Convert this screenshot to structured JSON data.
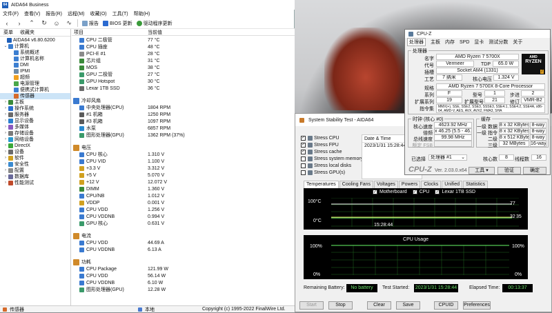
{
  "aida": {
    "title": "AIDA64 Business",
    "icon_text": "64",
    "menu": [
      "文件(F)",
      "查看(V)",
      "报告(R)",
      "远程(M)",
      "收藏(O)",
      "工具(T)",
      "帮助(H)"
    ],
    "toolbar": {
      "report": "报告",
      "bios": "BIOS 更新",
      "driver": "驱动程序更新"
    },
    "tabs": [
      "菜单",
      "收藏夹"
    ],
    "tree": [
      {
        "label": "AIDA64 v6.80.6200",
        "level": 0,
        "chev": "",
        "icon": "#1f5fb8"
      },
      {
        "label": "计算机",
        "level": 1,
        "chev": "⌄",
        "icon": "#3c7fd1"
      },
      {
        "label": "系统概述",
        "level": 2,
        "chev": "",
        "icon": "#3c7fd1"
      },
      {
        "label": "计算机名称",
        "level": 2,
        "chev": "",
        "icon": "#3c7fd1"
      },
      {
        "label": "DMI",
        "level": 2,
        "chev": "",
        "icon": "#3c7fd1"
      },
      {
        "label": "IPMI",
        "level": 2,
        "chev": "",
        "icon": "#6c8aa8"
      },
      {
        "label": "超频",
        "level": 2,
        "chev": "",
        "icon": "#f0a020"
      },
      {
        "label": "电源管理",
        "level": 2,
        "chev": "",
        "icon": "#4aa84a"
      },
      {
        "label": "便携式计算机",
        "level": 2,
        "chev": "",
        "icon": "#3c7fd1"
      },
      {
        "label": "传感器",
        "level": 2,
        "chev": "",
        "icon": "#d66a2a",
        "selected": true
      },
      {
        "label": "主板",
        "level": 1,
        "chev": "›",
        "icon": "#3a8a3a"
      },
      {
        "label": "操作系统",
        "level": 1,
        "chev": "›",
        "icon": "#2a6fd0"
      },
      {
        "label": "服务器",
        "level": 1,
        "chev": "›",
        "icon": "#6a6a6a"
      },
      {
        "label": "显示设备",
        "level": 1,
        "chev": "›",
        "icon": "#2a7fd0"
      },
      {
        "label": "多媒体",
        "level": 1,
        "chev": "›",
        "icon": "#8a5ac0"
      },
      {
        "label": "存储设备",
        "level": 1,
        "chev": "›",
        "icon": "#7a7a7a"
      },
      {
        "label": "网络设备",
        "level": 1,
        "chev": "›",
        "icon": "#2a9ad0"
      },
      {
        "label": "DirectX",
        "level": 1,
        "chev": "›",
        "icon": "#3aa83a"
      },
      {
        "label": "设备",
        "level": 1,
        "chev": "›",
        "icon": "#6a6a6a"
      },
      {
        "label": "软件",
        "level": 1,
        "chev": "›",
        "icon": "#d0a020"
      },
      {
        "label": "安全性",
        "level": 1,
        "chev": "›",
        "icon": "#3a8ad0"
      },
      {
        "label": "配置",
        "level": 1,
        "chev": "›",
        "icon": "#8a8a8a"
      },
      {
        "label": "数据库",
        "level": 1,
        "chev": "›",
        "icon": "#6a6a9a"
      },
      {
        "label": "性能测试",
        "level": 1,
        "chev": "›",
        "icon": "#c04a2a"
      }
    ],
    "col_item": "项目",
    "col_value": "当前值",
    "rows": [
      {
        "name": "CPU 二极管",
        "value": "77 °C",
        "icon": "#3a7ad0"
      },
      {
        "name": "CPU 插座",
        "value": "48 °C",
        "icon": "#3a7ad0"
      },
      {
        "name": "PCI-E #1",
        "value": "28 °C",
        "icon": "#8a8a8a"
      },
      {
        "name": "芯片组",
        "value": "31 °C",
        "icon": "#3a8a3a"
      },
      {
        "name": "MOS",
        "value": "38 °C",
        "icon": "#3a8a3a"
      },
      {
        "name": "GPU 二极管",
        "value": "27 °C",
        "icon": "#3a9a6a"
      },
      {
        "name": "GPU Hotspot",
        "value": "30 °C",
        "icon": "#3a9a6a"
      },
      {
        "name": "Lexar 1TB SSD",
        "value": "36 °C",
        "icon": "#6a6a6a"
      },
      {
        "section": "冷却风扇",
        "icon": "#3a7ad0"
      },
      {
        "name": "中央处理器(CPU)",
        "value": "1804 RPM",
        "icon": "#3a7ad0"
      },
      {
        "name": "#1 机箱",
        "value": "1250 RPM",
        "icon": "#5a5a5a"
      },
      {
        "name": "#3 机箱",
        "value": "1097 RPM",
        "icon": "#5a5a5a"
      },
      {
        "name": "水泵",
        "value": "6857 RPM",
        "icon": "#2a8ad0"
      },
      {
        "name": "图形处理器(GPU)",
        "value": "1362 RPM  (37%)",
        "icon": "#3a9a6a"
      },
      {
        "section": "电压",
        "icon": "#d08a2a"
      },
      {
        "name": "CPU 核心",
        "value": "1.310 V",
        "icon": "#3a7ad0"
      },
      {
        "name": "CPU VID",
        "value": "1.100 V",
        "icon": "#3a7ad0"
      },
      {
        "name": "+3.3 V",
        "value": "3.312 V",
        "icon": "#d0a020"
      },
      {
        "name": "+5 V",
        "value": "5.070 V",
        "icon": "#d0a020"
      },
      {
        "name": "+12 V",
        "value": "12.072 V",
        "icon": "#d0a020"
      },
      {
        "name": "DIMM",
        "value": "1.360 V",
        "icon": "#3a8a3a"
      },
      {
        "name": "CPU/NB",
        "value": "1.012 V",
        "icon": "#3a7ad0"
      },
      {
        "name": "VDDP",
        "value": "0.001 V",
        "icon": "#d0a020"
      },
      {
        "name": "CPU VDD",
        "value": "1.256 V",
        "icon": "#3a7ad0"
      },
      {
        "name": "CPU VDDNB",
        "value": "0.994 V",
        "icon": "#3a7ad0"
      },
      {
        "name": "GPU 核心",
        "value": "0.631 V",
        "icon": "#3a9a6a"
      },
      {
        "section": "电流",
        "icon": "#d08a2a"
      },
      {
        "name": "CPU VDD",
        "value": "44.69 A",
        "icon": "#3a7ad0"
      },
      {
        "name": "CPU VDDNB",
        "value": "6.13 A",
        "icon": "#3a7ad0"
      },
      {
        "section": "功耗",
        "icon": "#d08a2a"
      },
      {
        "name": "CPU Package",
        "value": "121.99 W",
        "icon": "#3a7ad0"
      },
      {
        "name": "CPU VDD",
        "value": "56.14 W",
        "icon": "#3a7ad0"
      },
      {
        "name": "CPU VDDNB",
        "value": "6.10 W",
        "icon": "#3a7ad0"
      },
      {
        "name": "图形处理器(GPU)",
        "value": "12.28 W",
        "icon": "#3a9a6a"
      }
    ],
    "status_left": "传感器",
    "status_mid": "本地",
    "status_right": "Copyright (c) 1995-2022 FinalWire Ltd."
  },
  "sst": {
    "title": "System Stability Test - AIDA64",
    "checks": [
      {
        "label": "Stress CPU",
        "checked": true
      },
      {
        "label": "Stress FPU",
        "checked": true
      },
      {
        "label": "Stress cache",
        "checked": true
      },
      {
        "label": "Stress system memory",
        "checked": false
      },
      {
        "label": "Stress local disks",
        "checked": false
      },
      {
        "label": "Stress GPU(s)",
        "checked": false
      }
    ],
    "table_header": "Date & Time",
    "table_value": "2023/1/31 15:28:44",
    "tabs": [
      "Temperatures",
      "Cooling Fans",
      "Voltages",
      "Powers",
      "Clocks",
      "Unified",
      "Statistics"
    ],
    "legend": [
      "Motherboard",
      "CPU",
      "Lexar 1TB SSD"
    ],
    "temp_top": "100°C",
    "temp_bottom": "0°C",
    "temp_time": "15:28:44",
    "temp_v1": "77",
    "temp_v2": "32",
    "temp_v3": "35",
    "cpu_usage_title": "CPU Usage",
    "cpu_top": "100%",
    "cpu_bottom": "0%",
    "cpu_right_top": "100%",
    "cpu_right_bottom": "0%",
    "remaining_battery_label": "Remaining Battery:",
    "remaining_battery": "No battery",
    "test_started_label": "Test Started:",
    "test_started": "2023/1/31 15:28:44",
    "elapsed_label": "Elapsed Time:",
    "elapsed": "00:13:37",
    "buttons": [
      "Start",
      "Stop",
      "Clear",
      "Save",
      "CPUID",
      "Preferences"
    ]
  },
  "cpuz": {
    "title": "CPU-Z",
    "tabs": [
      "处理器",
      "主板",
      "内存",
      "SPD",
      "显卡",
      "测试分数",
      "关于"
    ],
    "group_processor": "处理器",
    "name_label": "名字",
    "name": "AMD Ryzen 7 5700X",
    "codename_label": "代号",
    "codename": "Vermeer",
    "tdp_label": "TDP",
    "tdp": "65.0 W",
    "socket_label": "插槽",
    "socket": "Socket AM4 (1331)",
    "tech_label": "工艺",
    "tech": "7 纳米",
    "voltage_label": "核心电压",
    "voltage": "1.324 V",
    "spec_label": "规格",
    "spec": "AMD Ryzen 7 5700X 8-Core Processor",
    "family_label": "系列",
    "family": "F",
    "model_label": "型号",
    "model": "1",
    "stepping_label": "步进",
    "stepping": "2",
    "extfamily_label": "扩展系列",
    "extfamily": "19",
    "extmodel_label": "扩展型号",
    "extmodel": "21",
    "revision_label": "修订",
    "revision": "VMR-B2",
    "instr_label": "指令集",
    "instr": "MMX(+), SSE, SSE2, SSE3, SSSE3, SSE4.1, SSE4.2, SSE4A, x86-64, AMD-V, AES, AVX, AVX2, FMA3, SHA",
    "clock_group": "时钟 (核心 #0)",
    "core_speed_label": "核心速度",
    "core_speed": "4623.92 MHz",
    "multiplier_label": "倍频",
    "multiplier": "x 46.25 (5.5 - 46.5)",
    "bus_label": "总线速度",
    "bus": "99.98 MHz",
    "fsb_label": "额定 FSB",
    "cache_group": "缓存",
    "l1d_label": "一级 数据",
    "l1d": "8 x 32 KBytes",
    "l1d_way": "8-way",
    "l1i_label": "一级 指令",
    "l1i": "8 x 32 KBytes",
    "l1i_way": "8-way",
    "l2_label": "二级",
    "l2": "8 x 512 KBytes",
    "l2_way": "8-way",
    "l3_label": "三级",
    "l3": "32 MBytes",
    "l3_way": "16-way",
    "select_label": "已选择",
    "select_value": "处理器 #1",
    "cores_label": "核心数",
    "cores": "8",
    "threads_label": "线程数",
    "threads": "16",
    "logo": "CPU-Z",
    "version": "Ver. 2.03.0.x64",
    "tools_btn": "工具",
    "validate_btn": "验证",
    "ok_btn": "确定",
    "amd_logo_top": "AMD",
    "amd_logo_mid": "RYZEN",
    "amd_logo_num": "7"
  }
}
